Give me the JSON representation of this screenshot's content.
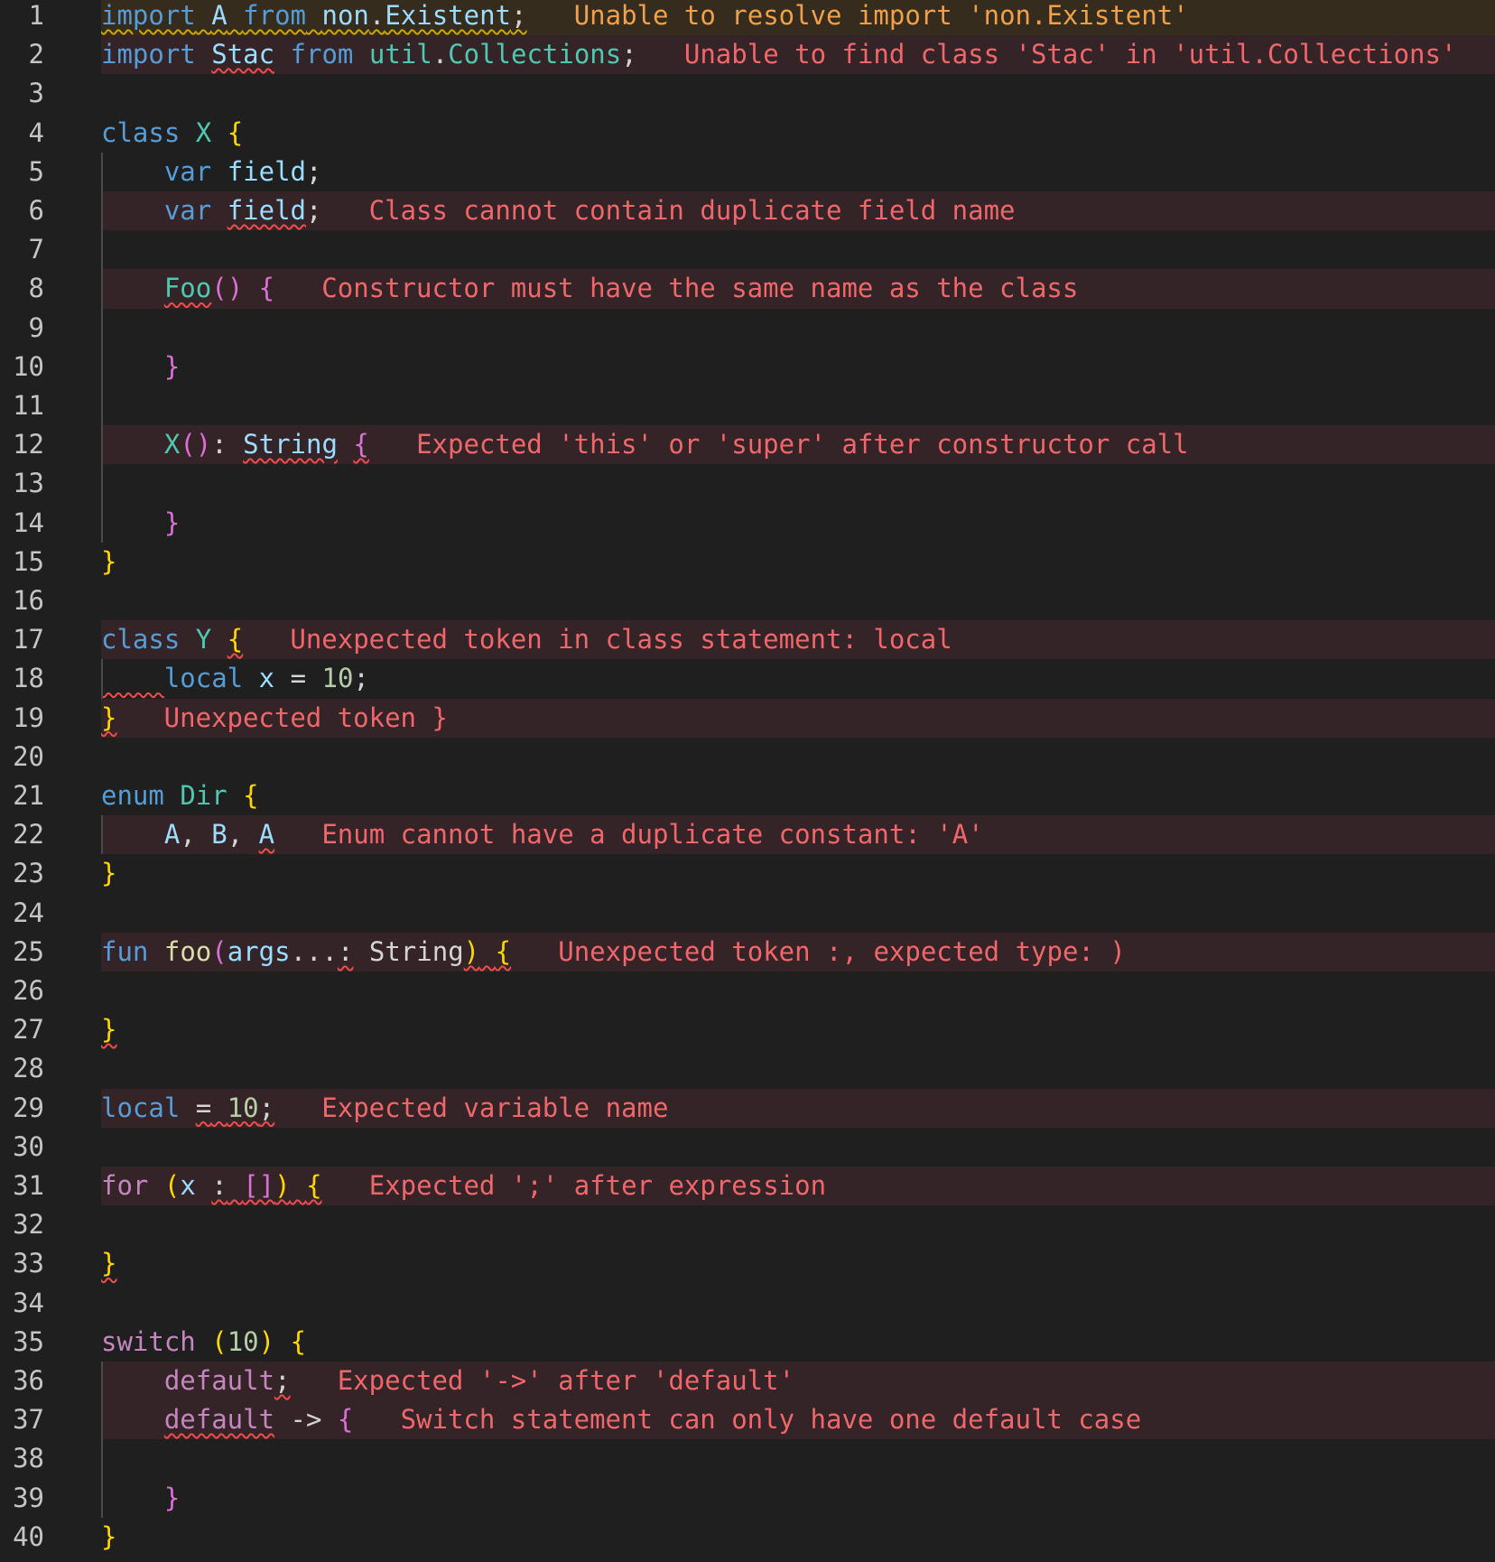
{
  "editor": {
    "lines": [
      {
        "n": "1",
        "hl": "warn",
        "tokens": [
          [
            "import",
            "kw",
            "w"
          ],
          [
            " ",
            "pu",
            "w"
          ],
          [
            "A",
            "va",
            "w"
          ],
          [
            " ",
            "pu",
            "w"
          ],
          [
            "from",
            "kw",
            "w"
          ],
          [
            " ",
            "pu",
            "w"
          ],
          [
            "non",
            "va",
            "w"
          ],
          [
            ".",
            "pu",
            "w"
          ],
          [
            "Existent",
            "va",
            "w"
          ],
          [
            ";",
            "pu",
            "w"
          ]
        ],
        "msg": {
          "text": "Unable to resolve import 'non.Existent'",
          "level": "warn"
        }
      },
      {
        "n": "2",
        "hl": "err",
        "tokens": [
          [
            "import",
            "kw"
          ],
          [
            " ",
            "pu"
          ],
          [
            "Stac",
            "va",
            "e"
          ],
          [
            " ",
            "pu"
          ],
          [
            "from",
            "kw"
          ],
          [
            " ",
            "pu"
          ],
          [
            "util",
            "ty"
          ],
          [
            ".",
            "pu"
          ],
          [
            "Collections",
            "ty"
          ],
          [
            ";",
            "pu"
          ]
        ],
        "msg": {
          "text": "Unable to find class 'Stac' in 'util.Collections'",
          "level": "err"
        }
      },
      {
        "n": "3",
        "tokens": []
      },
      {
        "n": "4",
        "tokens": [
          [
            "class",
            "kw"
          ],
          [
            " ",
            "pu"
          ],
          [
            "X",
            "ty"
          ],
          [
            " ",
            "pu"
          ],
          [
            "{",
            "b1"
          ]
        ]
      },
      {
        "n": "5",
        "tokens": [
          [
            "    ",
            "pu"
          ],
          [
            "var",
            "kw"
          ],
          [
            " ",
            "pu"
          ],
          [
            "field",
            "va"
          ],
          [
            ";",
            "pu"
          ]
        ]
      },
      {
        "n": "6",
        "hl": "err",
        "tokens": [
          [
            "    ",
            "pu"
          ],
          [
            "var",
            "kw"
          ],
          [
            " ",
            "pu"
          ],
          [
            "field",
            "va",
            "e"
          ],
          [
            ";",
            "pu"
          ]
        ],
        "msg": {
          "text": "Class cannot contain duplicate field name",
          "level": "err"
        }
      },
      {
        "n": "7",
        "tokens": []
      },
      {
        "n": "8",
        "hl": "err",
        "tokens": [
          [
            "    ",
            "pu"
          ],
          [
            "Foo",
            "ty",
            "e"
          ],
          [
            "()",
            "b2"
          ],
          [
            " ",
            "pu"
          ],
          [
            "{",
            "b2"
          ]
        ],
        "msg": {
          "text": "Constructor must have the same name as the class",
          "level": "err"
        }
      },
      {
        "n": "9",
        "tokens": []
      },
      {
        "n": "10",
        "tokens": [
          [
            "    ",
            "pu"
          ],
          [
            "}",
            "b2"
          ]
        ]
      },
      {
        "n": "11",
        "tokens": []
      },
      {
        "n": "12",
        "hl": "err",
        "tokens": [
          [
            "    ",
            "pu"
          ],
          [
            "X",
            "ty"
          ],
          [
            "()",
            "b2"
          ],
          [
            ":",
            "pu"
          ],
          [
            " ",
            "pu"
          ],
          [
            "String",
            "va",
            "e"
          ],
          [
            " ",
            "pu"
          ],
          [
            "{",
            "b2",
            "e"
          ]
        ],
        "msg": {
          "text": "Expected 'this' or 'super' after constructor call",
          "level": "err"
        }
      },
      {
        "n": "13",
        "tokens": []
      },
      {
        "n": "14",
        "tokens": [
          [
            "    ",
            "pu"
          ],
          [
            "}",
            "b2"
          ]
        ]
      },
      {
        "n": "15",
        "tokens": [
          [
            "}",
            "b1"
          ]
        ]
      },
      {
        "n": "16",
        "tokens": []
      },
      {
        "n": "17",
        "hl": "err",
        "tokens": [
          [
            "class",
            "kw"
          ],
          [
            " ",
            "pu"
          ],
          [
            "Y",
            "ty"
          ],
          [
            " ",
            "pu"
          ],
          [
            "{",
            "b1",
            "e"
          ]
        ],
        "msg": {
          "text": "Unexpected token in class statement: local",
          "level": "err"
        }
      },
      {
        "n": "18",
        "tokens": [
          [
            "    ",
            "pu",
            "e"
          ],
          [
            "local",
            "kw"
          ],
          [
            " ",
            "pu"
          ],
          [
            "x",
            "va"
          ],
          [
            " ",
            "pu"
          ],
          [
            "=",
            "pu"
          ],
          [
            " ",
            "pu"
          ],
          [
            "10",
            "nu"
          ],
          [
            ";",
            "pu"
          ]
        ]
      },
      {
        "n": "19",
        "hl": "err",
        "tokens": [
          [
            "}",
            "b1",
            "e"
          ]
        ],
        "msg": {
          "text": "Unexpected token }",
          "level": "err"
        }
      },
      {
        "n": "20",
        "tokens": []
      },
      {
        "n": "21",
        "tokens": [
          [
            "enum",
            "kw"
          ],
          [
            " ",
            "pu"
          ],
          [
            "Dir",
            "ty"
          ],
          [
            " ",
            "pu"
          ],
          [
            "{",
            "b1"
          ]
        ]
      },
      {
        "n": "22",
        "hl": "err",
        "tokens": [
          [
            "    ",
            "pu"
          ],
          [
            "A",
            "va"
          ],
          [
            ",",
            "pu"
          ],
          [
            " ",
            "pu"
          ],
          [
            "B",
            "va"
          ],
          [
            ",",
            "pu"
          ],
          [
            " ",
            "pu"
          ],
          [
            "A",
            "va",
            "e"
          ]
        ],
        "msg": {
          "text": "Enum cannot have a duplicate constant: 'A'",
          "level": "err"
        }
      },
      {
        "n": "23",
        "tokens": [
          [
            "}",
            "b1"
          ]
        ]
      },
      {
        "n": "24",
        "tokens": []
      },
      {
        "n": "25",
        "hl": "err",
        "tokens": [
          [
            "fun",
            "kw"
          ],
          [
            " ",
            "pu"
          ],
          [
            "foo",
            "fn"
          ],
          [
            "(",
            "b2"
          ],
          [
            "args",
            "va"
          ],
          [
            "...",
            "pu"
          ],
          [
            ":",
            "pu",
            "e"
          ],
          [
            " ",
            "pu"
          ],
          [
            "String",
            "pu"
          ],
          [
            ")",
            "b1",
            "e"
          ],
          [
            " ",
            "pu",
            "e"
          ],
          [
            "{",
            "b1",
            "e"
          ]
        ],
        "msg": {
          "text": "Unexpected token :, expected type: )",
          "level": "err"
        }
      },
      {
        "n": "26",
        "tokens": []
      },
      {
        "n": "27",
        "tokens": [
          [
            "}",
            "b1",
            "e"
          ]
        ]
      },
      {
        "n": "28",
        "tokens": []
      },
      {
        "n": "29",
        "hl": "err",
        "tokens": [
          [
            "local",
            "kw"
          ],
          [
            " ",
            "pu"
          ],
          [
            "=",
            "pu",
            "e"
          ],
          [
            " ",
            "pu",
            "e"
          ],
          [
            "10",
            "nu",
            "e"
          ],
          [
            ";",
            "pu",
            "e"
          ]
        ],
        "msg": {
          "text": "Expected variable name",
          "level": "err"
        }
      },
      {
        "n": "30",
        "tokens": []
      },
      {
        "n": "31",
        "hl": "err",
        "tokens": [
          [
            "for",
            "ctl"
          ],
          [
            " ",
            "pu"
          ],
          [
            "(",
            "b1"
          ],
          [
            "x",
            "va"
          ],
          [
            " ",
            "pu"
          ],
          [
            ":",
            "pu",
            "e"
          ],
          [
            " ",
            "pu",
            "e"
          ],
          [
            "[]",
            "b2",
            "e"
          ],
          [
            ")",
            "b1",
            "e"
          ],
          [
            " ",
            "pu",
            "e"
          ],
          [
            "{",
            "b1",
            "e"
          ]
        ],
        "msg": {
          "text": "Expected ';' after expression",
          "level": "err"
        }
      },
      {
        "n": "32",
        "tokens": []
      },
      {
        "n": "33",
        "tokens": [
          [
            "}",
            "b1",
            "e"
          ]
        ]
      },
      {
        "n": "34",
        "tokens": []
      },
      {
        "n": "35",
        "tokens": [
          [
            "switch",
            "ctl"
          ],
          [
            " ",
            "pu"
          ],
          [
            "(",
            "b1"
          ],
          [
            "10",
            "nu"
          ],
          [
            ")",
            "b1"
          ],
          [
            " ",
            "pu"
          ],
          [
            "{",
            "b1"
          ]
        ]
      },
      {
        "n": "36",
        "hl": "err",
        "tokens": [
          [
            "    ",
            "pu"
          ],
          [
            "default",
            "ctl"
          ],
          [
            ";",
            "pu",
            "e"
          ]
        ],
        "msg": {
          "text": "Expected '->' after 'default'",
          "level": "err"
        }
      },
      {
        "n": "37",
        "hl": "err",
        "tokens": [
          [
            "    ",
            "pu"
          ],
          [
            "default",
            "ctl",
            "e"
          ],
          [
            " ",
            "pu"
          ],
          [
            "->",
            "pu"
          ],
          [
            " ",
            "pu"
          ],
          [
            "{",
            "b2"
          ]
        ],
        "msg": {
          "text": "Switch statement can only have one default case",
          "level": "err"
        }
      },
      {
        "n": "38",
        "tokens": []
      },
      {
        "n": "39",
        "tokens": [
          [
            "    ",
            "pu"
          ],
          [
            "}",
            "b2"
          ]
        ]
      },
      {
        "n": "40",
        "tokens": [
          [
            "}",
            "b1"
          ]
        ]
      }
    ],
    "indent_guides": [
      {
        "from": 5,
        "to": 14
      },
      {
        "from": 18,
        "to": 18
      },
      {
        "from": 22,
        "to": 22
      },
      {
        "from": 36,
        "to": 39
      }
    ]
  }
}
